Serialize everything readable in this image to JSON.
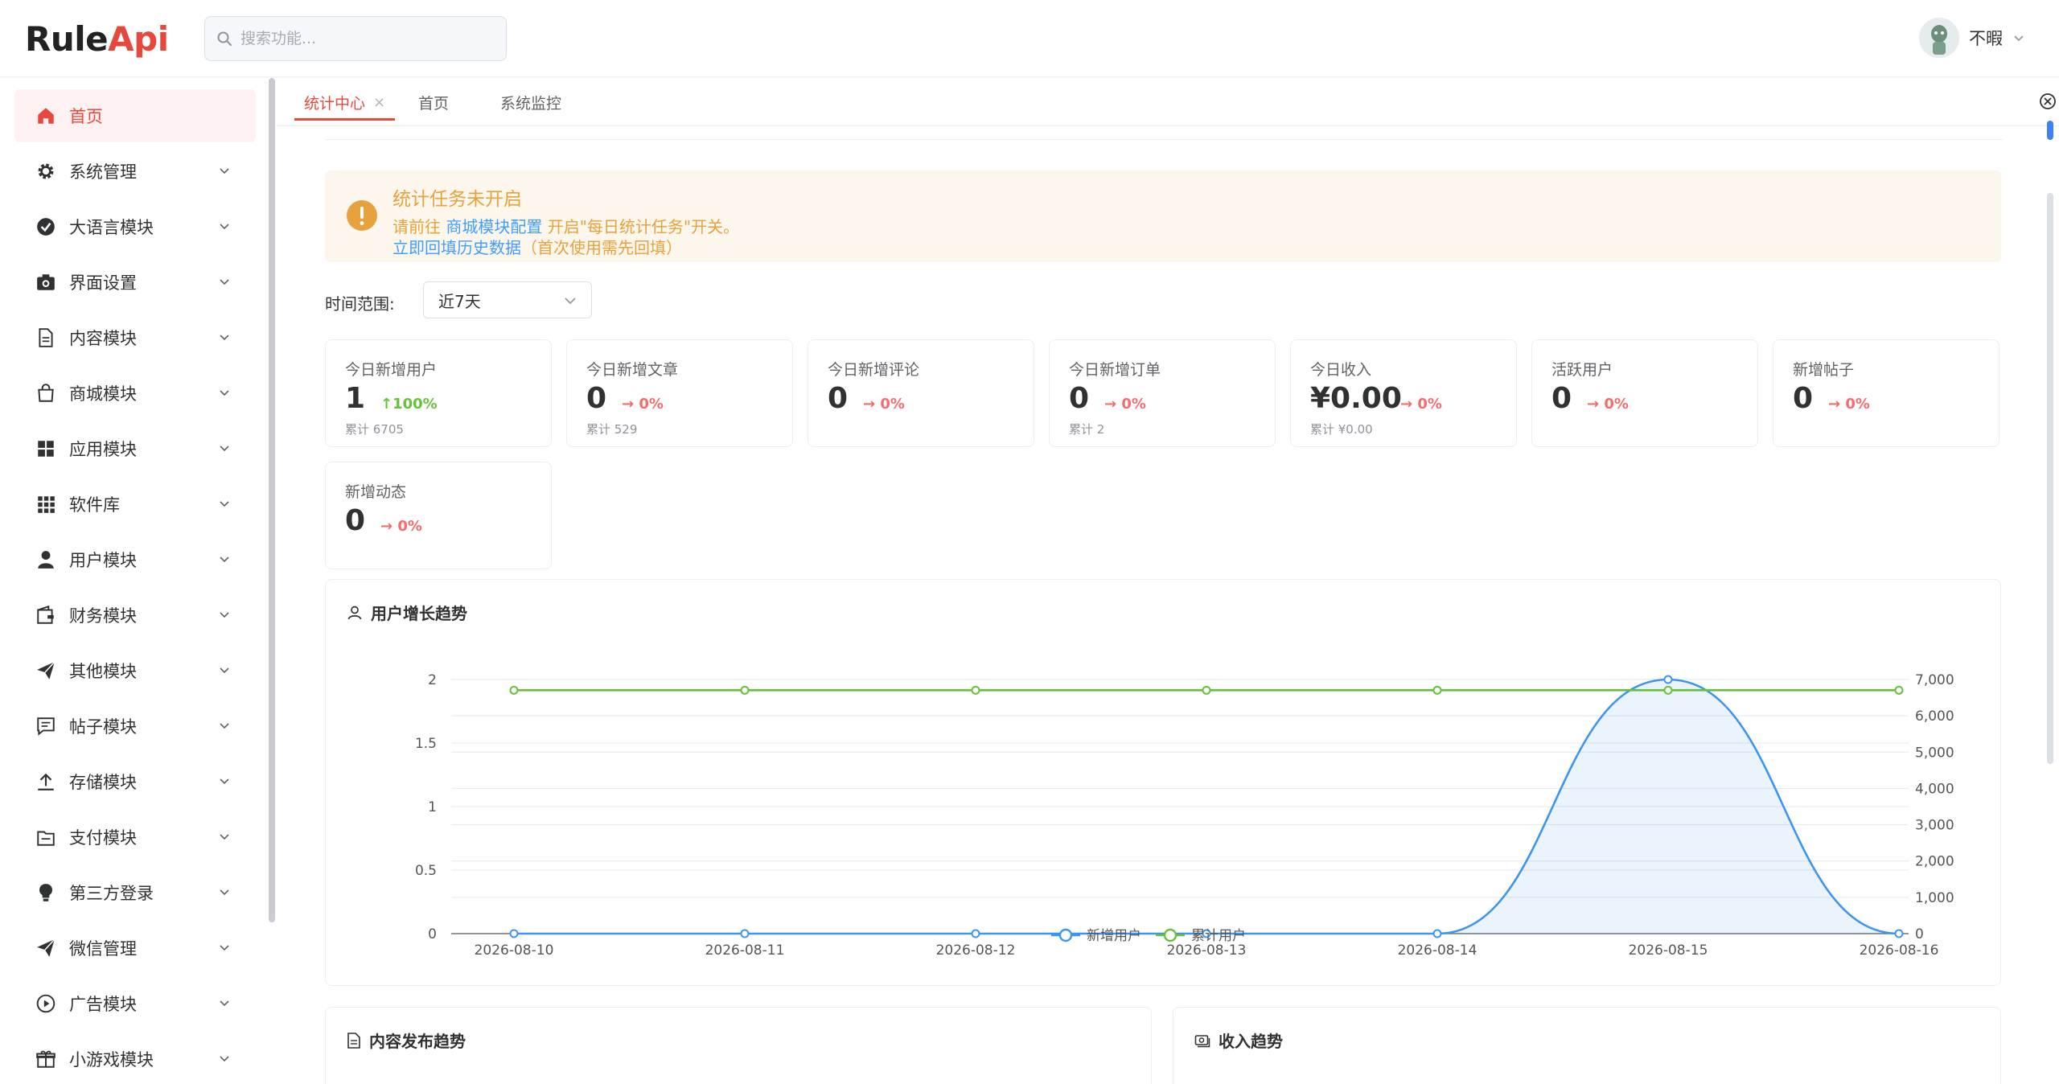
{
  "app": {
    "logo_part1": "Rule",
    "logo_part2": "Api",
    "accent": "#e8473c"
  },
  "search": {
    "placeholder": "搜索功能..."
  },
  "user": {
    "name": "不暇"
  },
  "sidebar": {
    "items": [
      {
        "label": "首页",
        "icon": "home-icon",
        "active": true,
        "expandable": false
      },
      {
        "label": "系统管理",
        "icon": "gear-icon",
        "expandable": true
      },
      {
        "label": "大语言模块",
        "icon": "check-circle-icon",
        "expandable": true
      },
      {
        "label": "界面设置",
        "icon": "camera-icon",
        "expandable": true
      },
      {
        "label": "内容模块",
        "icon": "document-icon",
        "expandable": true
      },
      {
        "label": "商城模块",
        "icon": "shopping-bag-icon",
        "expandable": true
      },
      {
        "label": "应用模块",
        "icon": "grid-icon",
        "expandable": true
      },
      {
        "label": "软件库",
        "icon": "apps-icon",
        "expandable": true
      },
      {
        "label": "用户模块",
        "icon": "user-icon",
        "expandable": true
      },
      {
        "label": "财务模块",
        "icon": "wallet-icon",
        "expandable": true
      },
      {
        "label": "其他模块",
        "icon": "paper-plane-icon",
        "expandable": true
      },
      {
        "label": "帖子模块",
        "icon": "chat-icon",
        "expandable": true
      },
      {
        "label": "存储模块",
        "icon": "upload-icon",
        "expandable": true
      },
      {
        "label": "支付模块",
        "icon": "payment-icon",
        "expandable": true
      },
      {
        "label": "第三方登录",
        "icon": "bulb-icon",
        "expandable": true
      },
      {
        "label": "微信管理",
        "icon": "send-icon",
        "expandable": true
      },
      {
        "label": "广告模块",
        "icon": "play-circle-icon",
        "expandable": true
      },
      {
        "label": "小游戏模块",
        "icon": "gift-icon",
        "expandable": true
      }
    ]
  },
  "tabs": [
    {
      "label": "统计中心",
      "active": true,
      "closable": true
    },
    {
      "label": "首页",
      "active": false
    },
    {
      "label": "系统监控",
      "active": false
    }
  ],
  "alert": {
    "title": "统计任务未开启",
    "line1_prefix": "请前往 ",
    "line1_link": "商城模块配置",
    "line1_suffix": " 开启\"每日统计任务\"开关。",
    "line2_link": "立即回填历史数据",
    "line2_suffix": "（首次使用需先回填）"
  },
  "filter": {
    "label": "时间范围:",
    "value": "近7天"
  },
  "stats": [
    {
      "title": "今日新增用户",
      "value": "1",
      "trend": "↑100%",
      "dir": "up",
      "total": "累计 6705"
    },
    {
      "title": "今日新增文章",
      "value": "0",
      "trend": "→ 0%",
      "dir": "down",
      "total": "累计 529"
    },
    {
      "title": "今日新增评论",
      "value": "0",
      "trend": "→ 0%",
      "dir": "down",
      "total": ""
    },
    {
      "title": "今日新增订单",
      "value": "0",
      "trend": "→ 0%",
      "dir": "down",
      "total": "累计 2"
    },
    {
      "title": "今日收入",
      "value": "¥0.00",
      "trend": "→ 0%",
      "dir": "down",
      "total": "累计 ¥0.00"
    },
    {
      "title": "活跃用户",
      "value": "0",
      "trend": "→ 0%",
      "dir": "down",
      "total": ""
    },
    {
      "title": "新增帖子",
      "value": "0",
      "trend": "→ 0%",
      "dir": "down",
      "total": ""
    },
    {
      "title": "新增动态",
      "value": "0",
      "trend": "→ 0%",
      "dir": "down",
      "total": ""
    }
  ],
  "panels": {
    "user_growth": "用户增长趋势",
    "content_trend": "内容发布趋势",
    "income_trend": "收入趋势"
  },
  "chart_data": {
    "type": "line",
    "title": "用户增长趋势",
    "x": [
      "2026-08-10",
      "2026-08-11",
      "2026-08-12",
      "2026-08-13",
      "2026-08-14",
      "2026-08-15",
      "2026-08-16"
    ],
    "series": [
      {
        "name": "新增用户",
        "axis": "left",
        "values": [
          0,
          0,
          0,
          0,
          0,
          2,
          0
        ],
        "color": "#3b96f0",
        "smooth": true,
        "area": true
      },
      {
        "name": "累计用户",
        "axis": "right",
        "values": [
          6705,
          6705,
          6705,
          6705,
          6705,
          6705,
          6705
        ],
        "color": "#67c23a"
      }
    ],
    "y_left": {
      "range": [
        0,
        2
      ],
      "ticks": [
        "0",
        "0.5",
        "1",
        "1.5",
        "2"
      ]
    },
    "y_right": {
      "range": [
        0,
        7000
      ],
      "ticks": [
        "0",
        "1,000",
        "2,000",
        "3,000",
        "4,000",
        "5,000",
        "6,000",
        "7,000"
      ]
    },
    "grid": true,
    "legend": "bottom-center"
  }
}
